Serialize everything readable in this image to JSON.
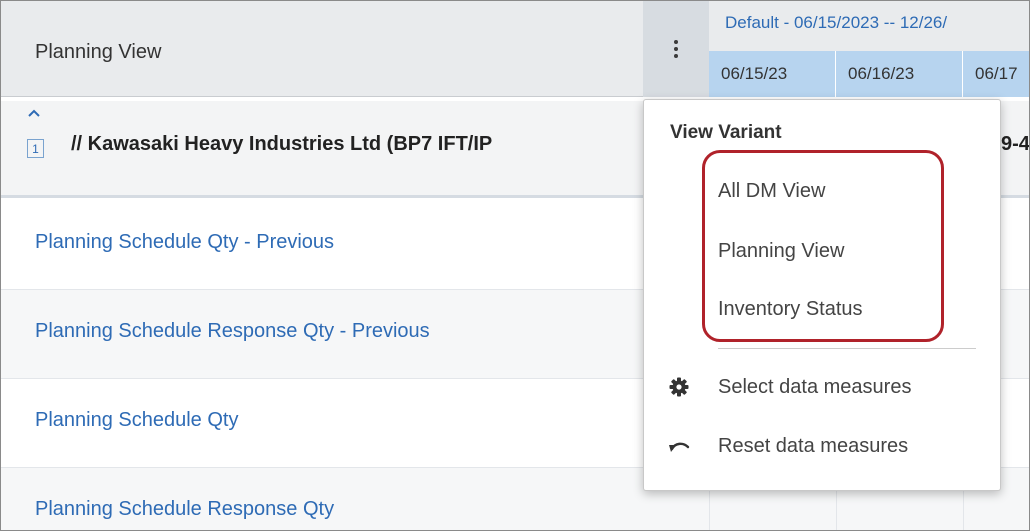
{
  "header": {
    "title": "Planning View",
    "date_range_label": "Default - 06/15/2023 -- 12/26/",
    "dates": [
      "06/15/23",
      "06/16/23",
      "06/17"
    ]
  },
  "group": {
    "count": "1",
    "title": "// Kawasaki Heavy Industries Ltd (BP7 IFT/IP",
    "suffix": "9-4"
  },
  "rows": [
    {
      "label": "Planning Schedule Qty - Previous"
    },
    {
      "label": "Planning Schedule Response Qty - Previous"
    },
    {
      "label": "Planning Schedule Qty"
    },
    {
      "label": "Planning Schedule Response Qty"
    }
  ],
  "menu": {
    "heading": "View Variant",
    "variants": [
      "All DM View",
      "Planning View",
      "Inventory Status"
    ],
    "actions": [
      {
        "label": "Select data measures",
        "icon": "gear-icon"
      },
      {
        "label": "Reset data measures",
        "icon": "undo-icon"
      }
    ]
  },
  "colors": {
    "link": "#2e6bb5",
    "date_header": "#b7d4ef",
    "highlight": "#b0222a"
  }
}
